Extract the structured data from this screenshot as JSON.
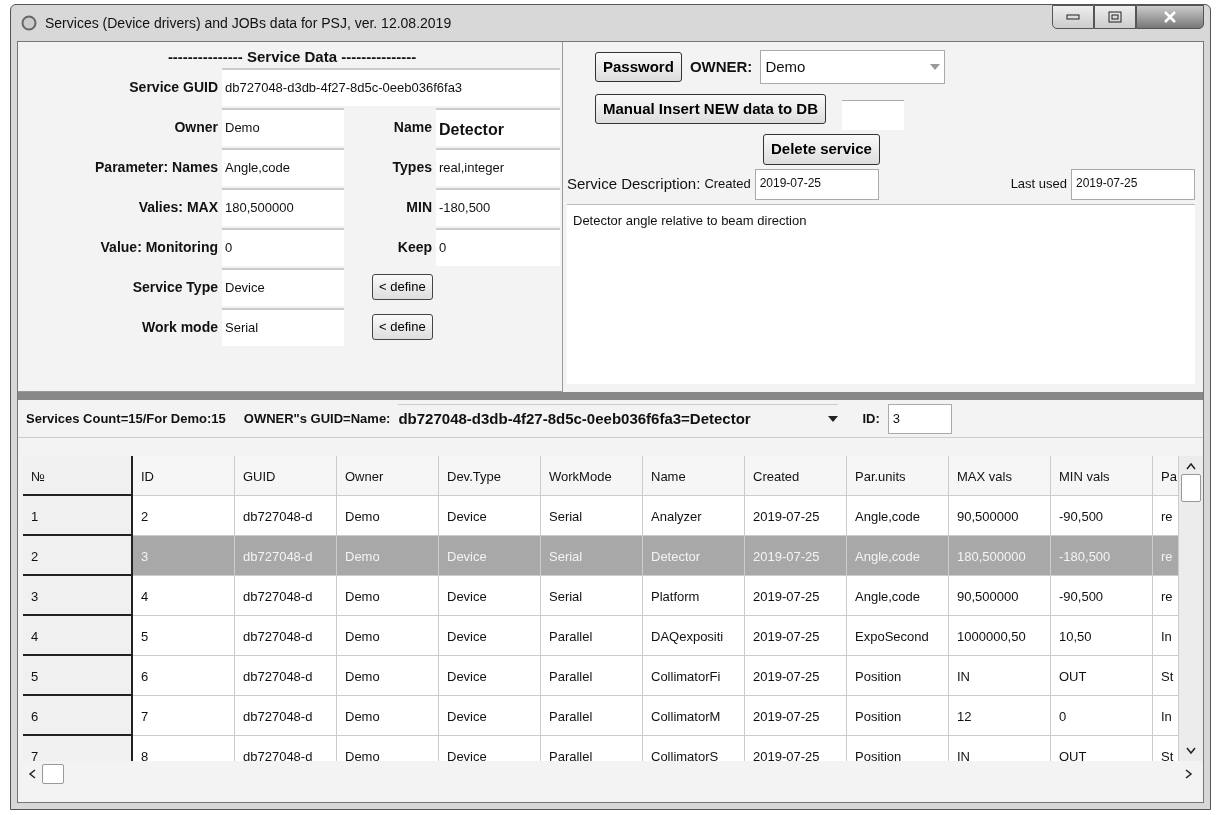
{
  "window": {
    "title": "Services (Device drivers) and JOBs data for PSJ, ver. 12.08.2019"
  },
  "service_data": {
    "heading": "--------------- Service Data ---------------",
    "guid": {
      "label": "Service GUID",
      "value": "db727048-d3db-4f27-8d5c-0eeb036f6fa3"
    },
    "rows": [
      {
        "kind": "pair",
        "label": "Owner",
        "value": "Demo",
        "label2": "Name",
        "value2": "Detector"
      },
      {
        "kind": "pair",
        "label": "Parameter: Names",
        "value": "Angle,code",
        "label2": "Types",
        "value2": "real,integer"
      },
      {
        "kind": "pair",
        "label": "Valies: MAX",
        "value": "180,500000",
        "label2": "MIN",
        "value2": "-180,500"
      },
      {
        "kind": "pair",
        "label": "Value: Monitoring",
        "value": "0",
        "label2": "Keep",
        "value2": "0"
      },
      {
        "kind": "define",
        "label": "Service Type",
        "value": "Device",
        "button": "< define"
      },
      {
        "kind": "define",
        "label": "Work mode",
        "value": "Serial",
        "button": "< define"
      }
    ]
  },
  "actions": {
    "password_button": "Password",
    "owner_label": "OWNER:",
    "owner_value": "Demo",
    "insert_button": "Manual Insert NEW data to DB",
    "delete_button": "Delete service"
  },
  "description": {
    "label": "Service Description:",
    "created_label": "Created",
    "created": "2019-07-25",
    "last_used_label": "Last used",
    "last_used": "2019-07-25",
    "text": "Detector angle relative to beam direction"
  },
  "info_bar": {
    "count": "Services Count=15/For Demo:15",
    "guid_label": "OWNER\"s GUID=Name:",
    "guid_value": "db727048-d3db-4f27-8d5c-0eeb036f6fa3=Detector",
    "id_label": "ID:",
    "id_value": "3"
  },
  "table": {
    "columns": [
      "№",
      "ID",
      "GUID",
      "Owner",
      "Dev.Type",
      "WorkMode",
      "Name",
      "Created",
      "Par.units",
      "MAX vals",
      "MIN vals",
      "Pa"
    ],
    "rows": [
      {
        "selected": false,
        "cells": [
          "1",
          "2",
          "db727048-d",
          "Demo",
          "Device",
          "Serial",
          "Analyzer",
          "2019-07-25",
          "Angle,code",
          "90,500000",
          "-90,500",
          "re"
        ]
      },
      {
        "selected": true,
        "cells": [
          "2",
          "3",
          "db727048-d",
          "Demo",
          "Device",
          "Serial",
          "Detector",
          "2019-07-25",
          "Angle,code",
          "180,500000",
          "-180,500",
          "re"
        ]
      },
      {
        "selected": false,
        "cells": [
          "3",
          "4",
          "db727048-d",
          "Demo",
          "Device",
          "Serial",
          "Platform",
          "2019-07-25",
          "Angle,code",
          "90,500000",
          "-90,500",
          "re"
        ]
      },
      {
        "selected": false,
        "cells": [
          "4",
          "5",
          "db727048-d",
          "Demo",
          "Device",
          "Parallel",
          "DAQexpositi",
          "2019-07-25",
          "ExpoSecond",
          "1000000,50",
          "10,50",
          "In"
        ]
      },
      {
        "selected": false,
        "cells": [
          "5",
          "6",
          "db727048-d",
          "Demo",
          "Device",
          "Parallel",
          "CollimatorFi",
          "2019-07-25",
          "Position",
          "IN",
          "OUT",
          "St"
        ]
      },
      {
        "selected": false,
        "cells": [
          "6",
          "7",
          "db727048-d",
          "Demo",
          "Device",
          "Parallel",
          "CollimatorM",
          "2019-07-25",
          "Position",
          "12",
          "0",
          "In"
        ]
      },
      {
        "selected": false,
        "cells": [
          "7",
          "8",
          "db727048-d",
          "Demo",
          "Device",
          "Parallel",
          "CollimatorS",
          "2019-07-25",
          "Position",
          "IN",
          "OUT",
          "St"
        ]
      }
    ]
  }
}
